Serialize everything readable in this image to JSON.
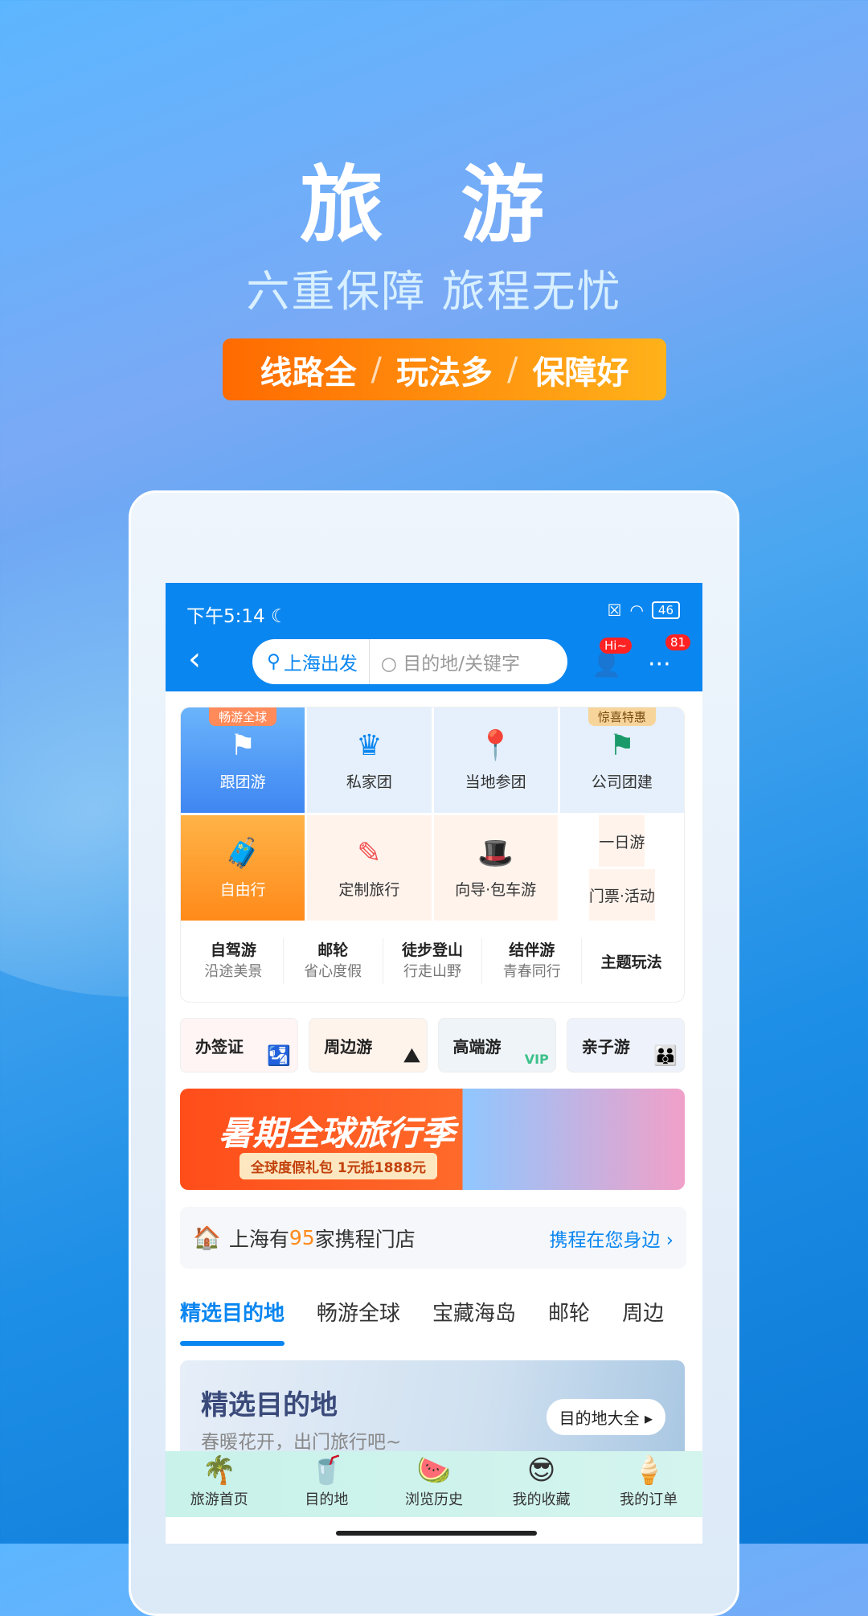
{
  "promo": {
    "title": "旅 游",
    "subtitle": "六重保障 旅程无忧",
    "pill": [
      "线路全",
      "玩法多",
      "保障好"
    ]
  },
  "status": {
    "time": "下午5:14",
    "battery": "46"
  },
  "nav": {
    "location": "上海出发",
    "placeholder": "目的地/关键字",
    "hi_badge": "Hi~",
    "more_badge": "81"
  },
  "grid": {
    "row1": [
      {
        "label": "跟团游",
        "tag": "畅游全球"
      },
      {
        "label": "私家团"
      },
      {
        "label": "当地参团"
      },
      {
        "label": "公司团建",
        "tag": "惊喜特惠"
      }
    ],
    "row2": [
      {
        "label": "自由行"
      },
      {
        "label": "定制旅行"
      },
      {
        "label": "向导·包车游"
      }
    ],
    "row2_split": [
      "一日游",
      "门票·活动"
    ],
    "row3": [
      {
        "title": "自驾游",
        "sub": "沿途美景"
      },
      {
        "title": "邮轮",
        "sub": "省心度假"
      },
      {
        "title": "徒步登山",
        "sub": "行走山野"
      },
      {
        "title": "结伴游",
        "sub": "青春同行"
      },
      {
        "title": "主题玩法"
      }
    ]
  },
  "shortcuts": [
    "办签证",
    "周边游",
    "高端游",
    "亲子游"
  ],
  "banner": {
    "title": "暑期全球旅行季",
    "sub": "全球度假礼包 1元抵1888元"
  },
  "store": {
    "prefix": "上海有",
    "count": "95",
    "suffix": "家携程门店",
    "link": "携程在您身边 ›"
  },
  "tabs": [
    "精选目的地",
    "畅游全球",
    "宝藏海岛",
    "邮轮",
    "周边"
  ],
  "dest": {
    "title": "精选目的地",
    "sub": "春暖花开，出门旅行吧~",
    "button": "目的地大全 ▸"
  },
  "bottom_nav": [
    "旅游首页",
    "目的地",
    "浏览历史",
    "我的收藏",
    "我的订单"
  ],
  "colors": {
    "primary": "#0a86f0",
    "accent": "#ff8a1a"
  }
}
